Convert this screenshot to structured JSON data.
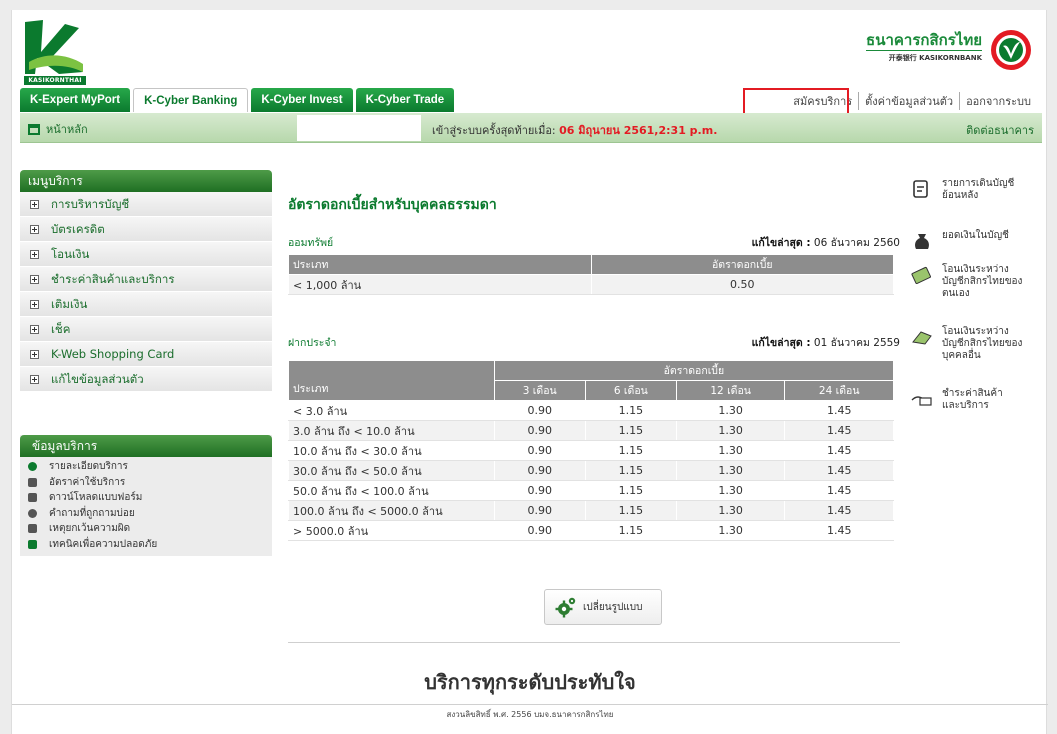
{
  "header": {
    "logo_caption": "KASIKORNTHAI",
    "bank_name_th": "ธนาคารกสิกรไทย",
    "bank_name_en": "开泰银行 KASIKORNBANK"
  },
  "tabs": [
    {
      "label": "K-Expert MyPort"
    },
    {
      "label": "K-Cyber Banking"
    },
    {
      "label": "K-Cyber Invest"
    },
    {
      "label": "K-Cyber Trade"
    }
  ],
  "top_links": {
    "register": "สมัครบริการ",
    "settings": "ตั้งค่าข้อมูลส่วนตัว",
    "logout": "ออกจากระบบ"
  },
  "bar": {
    "home": "หน้าหลัก",
    "last_login_label": "เข้าสู่ระบบครั้งสุดท้ายเมื่อ:",
    "last_login_value": "06 มิถุนายน 2561,2:31 p.m.",
    "contact": "ติดต่อธนาคาร"
  },
  "menu": {
    "title": "เมนูบริการ",
    "items": [
      {
        "label": "การบริหารบัญชี"
      },
      {
        "label": "บัตรเครดิต"
      },
      {
        "label": "โอนเงิน"
      },
      {
        "label": "ชำระค่าสินค้าและบริการ"
      },
      {
        "label": "เติมเงิน"
      },
      {
        "label": "เช็ค"
      },
      {
        "label": "K-Web Shopping Card"
      },
      {
        "label": "แก้ไขข้อมูลส่วนตัว"
      }
    ]
  },
  "info": {
    "title": "ข้อมูลบริการ",
    "items": [
      {
        "label": "รายละเอียดบริการ"
      },
      {
        "label": "อัตราค่าใช้บริการ"
      },
      {
        "label": "ดาวน์โหลดแบบฟอร์ม"
      },
      {
        "label": "คำถามที่ถูกถามบ่อย"
      },
      {
        "label": "เหตุยกเว้นความผิด"
      },
      {
        "label": "เทคนิคเพื่อความปลอดภัย"
      }
    ]
  },
  "main": {
    "title": "อัตราดอกเบี้ยสำหรับบุคคลธรรมดา",
    "savings": {
      "label": "ออมทรัพย์",
      "updated_label": "แก้ไขล่าสุด :",
      "updated_value": "06 ธันวาคม 2560",
      "headers": [
        "ประเภท",
        "อัตราดอกเบี้ย"
      ],
      "rows": [
        [
          "< 1,000 ล้าน",
          "0.50"
        ]
      ]
    },
    "fixed": {
      "label": "ฝากประจำ",
      "updated_label": "แก้ไขล่าสุด :",
      "updated_value": "01 ธันวาคม 2559",
      "group_header": "อัตราดอกเบี้ย",
      "headers": [
        "ประเภท",
        "3 เดือน",
        "6 เดือน",
        "12 เดือน",
        "24 เดือน"
      ],
      "rows": [
        [
          "< 3.0 ล้าน",
          "0.90",
          "1.15",
          "1.30",
          "1.45"
        ],
        [
          "3.0 ล้าน ถึง < 10.0 ล้าน",
          "0.90",
          "1.15",
          "1.30",
          "1.45"
        ],
        [
          "10.0 ล้าน ถึง < 30.0 ล้าน",
          "0.90",
          "1.15",
          "1.30",
          "1.45"
        ],
        [
          "30.0 ล้าน ถึง < 50.0 ล้าน",
          "0.90",
          "1.15",
          "1.30",
          "1.45"
        ],
        [
          "50.0 ล้าน ถึง < 100.0 ล้าน",
          "0.90",
          "1.15",
          "1.30",
          "1.45"
        ],
        [
          "100.0 ล้าน ถึง < 5000.0 ล้าน",
          "0.90",
          "1.15",
          "1.30",
          "1.45"
        ],
        [
          "> 5000.0 ล้าน",
          "0.90",
          "1.15",
          "1.30",
          "1.45"
        ]
      ]
    },
    "switch_button": "เปลี่ยนรูปแบบ"
  },
  "quick_links": [
    {
      "label": "รายการเดินบัญชีย้อนหลัง",
      "icon": "statement-icon"
    },
    {
      "label": "ยอดเงินในบัญชี",
      "icon": "money-bag-icon"
    },
    {
      "label": "โอนเงินระหว่างบัญชีกสิกรไทยของตนเอง",
      "icon": "transfer-own-icon"
    },
    {
      "label": "โอนเงินระหว่างบัญชีกสิกรไทยของบุคคลอื่น",
      "icon": "transfer-other-icon"
    },
    {
      "label": "ชำระค่าสินค้าและบริการ",
      "icon": "bill-payment-icon"
    }
  ],
  "footer": {
    "tagline": "บริการทุกระดับประทับใจ",
    "copyright": "สงวนลิขสิทธิ์ พ.ศ. 2556 บมจ.ธนาคารกสิกรไทย"
  },
  "colors": {
    "brand_green": "#0b7a2e",
    "highlight_red": "#e31b23"
  }
}
